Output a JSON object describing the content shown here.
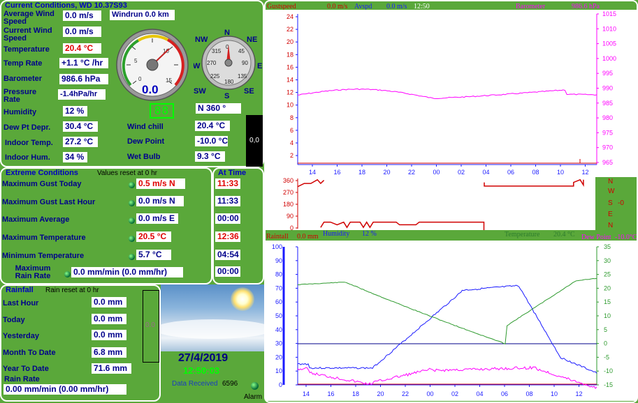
{
  "current": {
    "title": "Current Conditions, WD 10.37S93",
    "avg_wind_label": "Average Wind Speed",
    "avg_wind": "0.0 m/s",
    "windrun": "Windrun 0.0 km",
    "cur_wind_label": "Current Wind Speed",
    "cur_wind": "0.0 m/s",
    "temp_label": "Temperature",
    "temp": "20.4 °C",
    "temp_rate_label": "Temp Rate",
    "temp_rate": "+1.1 °C /hr",
    "baro_label": "Barometer",
    "baro": "986.6 hPa",
    "pressure_rate_label": "Pressure Rate",
    "pressure_rate": "-1.4hPa/hr",
    "humidity_label": "Humidity",
    "humidity": "12 %",
    "dew_depr_label": "Dew Pt Depr.",
    "dew_depr": "30.4 °C",
    "indoor_temp_label": "Indoor Temp.",
    "indoor_temp": "27.2 °C",
    "indoor_hum_label": "Indoor Hum.",
    "indoor_hum": "34 %",
    "wind_chill_label": "Wind chill",
    "wind_chill": "20.4 °C",
    "dew_point_label": "Dew Point",
    "dew_point": "-10.0 °C",
    "wet_bulb_label": "Wet Bulb",
    "wet_bulb": "9.3 °C",
    "wind_dir": "N  360 °",
    "solar": "0,0",
    "gauge_value": "0.0",
    "gauge_ticks": [
      "0",
      "5",
      "10",
      "15"
    ],
    "compass": {
      "n": "N",
      "ne": "NE",
      "e": "E",
      "se": "SE",
      "s": "S",
      "sw": "SW",
      "w": "W",
      "nw": "NW",
      "deg": [
        "0",
        "45",
        "90",
        "135",
        "180",
        "225",
        "270",
        "315"
      ]
    },
    "lcd": "88"
  },
  "extreme": {
    "title": "Extreme Conditions",
    "reset": "Values reset at 0 hr",
    "at_time": "At Time",
    "rows": [
      {
        "label": "Maximum Gust Today",
        "value": "0.5 m/s  N",
        "time": "11:33"
      },
      {
        "label": "Maximum Gust Last Hour",
        "value": "0.0 m/s  N",
        "time": "11:33"
      },
      {
        "label": "Maximum Average",
        "value": "0.0 m/s E",
        "time": "00:00"
      },
      {
        "label": "Maximum Temperature",
        "value": "20.5 °C",
        "time": "12:36"
      },
      {
        "label": "Minimum Temperature",
        "value": "5.7 °C",
        "time": "04:54"
      },
      {
        "label": "Maximum Rain Rate",
        "value": "0.0 mm/min (0.0 mm/hr)",
        "time": "00:00"
      }
    ]
  },
  "rain": {
    "title": "Rainfall",
    "reset": "Rain reset at 0 hr",
    "last_hour_label": "Last Hour",
    "last_hour": "0.0 mm",
    "today_label": "Today",
    "today": "0.0 mm",
    "yesterday_label": "Yesterday",
    "yesterday": "0.0 mm",
    "month_label": "Month To Date",
    "month": "6.8 mm",
    "year_label": "Year To Date",
    "year": "71.6 mm",
    "rate_label": "Rain Rate",
    "rate": "0.00 mm/min (0.00 mm/hr)",
    "gauge": "0.0"
  },
  "status": {
    "date": "27/4/2019",
    "time": "12:50:03",
    "data_received_label": "Data Received",
    "data_received": "6596",
    "alarm": "Alarm"
  },
  "graph1": {
    "gust_label": "Gustspeed",
    "gust_val": "0.0 m/s",
    "avg_label": "Avspd",
    "avg_val": "0.0 m/s",
    "time": "12:50",
    "baro_label": "Barometer",
    "baro_val": "986.6 hPa",
    "left_ticks": [
      "24",
      "22",
      "20",
      "18",
      "16",
      "14",
      "12",
      "10",
      "8",
      "6",
      "4",
      "2"
    ],
    "right_ticks": [
      "1015",
      "1010",
      "1005",
      "1000",
      "995",
      "990",
      "985",
      "980",
      "975",
      "970",
      "965"
    ],
    "x_ticks": [
      "14",
      "16",
      "18",
      "20",
      "22",
      "00",
      "02",
      "04",
      "06",
      "08",
      "10",
      "12"
    ]
  },
  "graph2": {
    "left_ticks": [
      "360",
      "270",
      "180",
      "90",
      "0"
    ],
    "dirs": [
      "N",
      "W",
      "S",
      "E",
      "N"
    ],
    "offset": "-0"
  },
  "graph3": {
    "rain_label": "Raintall",
    "rain_val": "0.0 mm",
    "hum_label": "Humidity",
    "hum_val": "12 %",
    "temp_label": "Temperature",
    "temp_val": "20.4 °C",
    "dew_label": "Dew Point",
    "dew_val": "-10.0°C",
    "left_ticks": [
      "100",
      "90",
      "80",
      "70",
      "60",
      "50",
      "40",
      "30",
      "20",
      "10",
      "0"
    ],
    "right_ticks": [
      "35",
      "30",
      "25",
      "20",
      "15",
      "10",
      "5",
      "0",
      "-5",
      "-10",
      "-15"
    ],
    "x_ticks": [
      "14",
      "16",
      "18",
      "20",
      "22",
      "00",
      "02",
      "04",
      "06",
      "08",
      "10",
      "12"
    ]
  },
  "colors": {
    "panel": "#5aa83a",
    "label": "#00008b",
    "title": "#0000c0",
    "red": "#e00000",
    "baro": "#ff00ff",
    "temp": "#2e9a2e",
    "hum": "#1a1aff"
  }
}
